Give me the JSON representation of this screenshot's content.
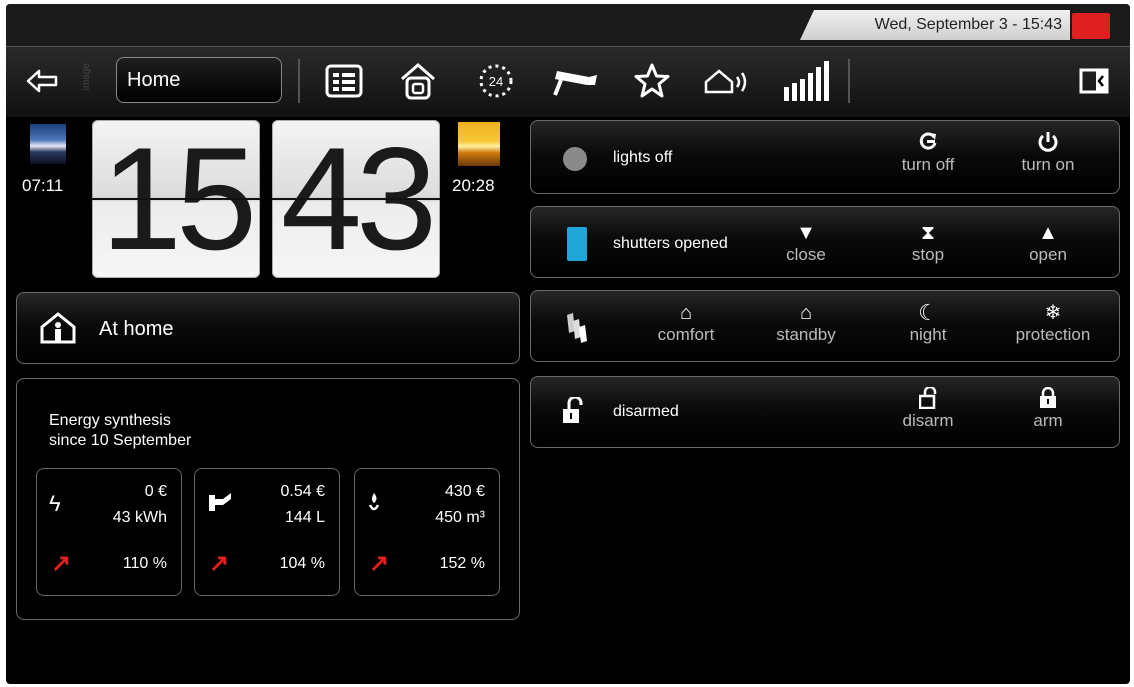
{
  "status": {
    "datetime": "Wed, September 3 - 15:43"
  },
  "toolbar": {
    "home_select": "Home",
    "side_text": "image",
    "icons": [
      "back-arrow-icon",
      "list-icon",
      "house-icon",
      "clock-24-icon",
      "camera-icon",
      "star-icon",
      "house-sound-icon",
      "signal-bars-icon",
      "panel-toggle-icon"
    ],
    "badge_24": "24"
  },
  "clock": {
    "sunrise": "07:11",
    "sunset": "20:28",
    "hours": "15",
    "minutes": "43"
  },
  "presence": {
    "label": "At home"
  },
  "energy": {
    "title_line1": "Energy synthesis",
    "title_line2": "since 10 September",
    "cards": [
      {
        "icon": "lightning-icon",
        "cost": "0 €",
        "amount": "43 kWh",
        "percent": "110 %"
      },
      {
        "icon": "water-tap-icon",
        "cost": "0.54 €",
        "amount": "144 L",
        "percent": "104 %"
      },
      {
        "icon": "gas-flame-icon",
        "cost": "430 €",
        "amount": "450 m³",
        "percent": "152 %"
      }
    ]
  },
  "lights": {
    "status": "lights off",
    "turn_off": "turn off",
    "turn_on": "turn on"
  },
  "shutters": {
    "status": "shutters opened",
    "close": "close",
    "stop": "stop",
    "open": "open"
  },
  "heating": {
    "comfort": "comfort",
    "standby": "standby",
    "night": "night",
    "protection": "protection"
  },
  "alarm": {
    "status": "disarmed",
    "disarm": "disarm",
    "arm": "arm"
  },
  "colors": {
    "accent_red": "#e02020",
    "shutter_blue": "#1fa6d6",
    "lights_gray": "#8a8a8a"
  }
}
